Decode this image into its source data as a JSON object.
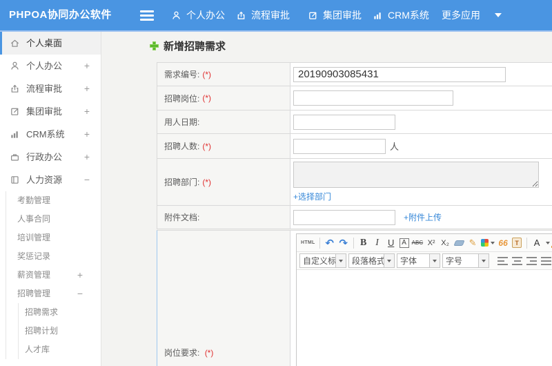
{
  "colors": {
    "topbar": "#4a95e2",
    "link": "#3788d8",
    "required": "#e03131",
    "active_accent": "#4a95e2"
  },
  "topbar": {
    "logo": "PHPOA协同办公软件",
    "menu": [
      {
        "label": "个人办公",
        "icon": "person-icon"
      },
      {
        "label": "流程审批",
        "icon": "flow-icon"
      },
      {
        "label": "集团审批",
        "icon": "edit-icon"
      },
      {
        "label": "CRM系统",
        "icon": "chart-icon"
      },
      {
        "label": "更多应用",
        "icon": "caret-down-icon"
      }
    ]
  },
  "sidebar": {
    "items": [
      {
        "label": "个人桌面",
        "icon": "home-icon",
        "active": true
      },
      {
        "label": "个人办公",
        "icon": "person-icon",
        "toggle": "+"
      },
      {
        "label": "流程审批",
        "icon": "flow-icon",
        "toggle": "+"
      },
      {
        "label": "集团审批",
        "icon": "edit-icon",
        "toggle": "+"
      },
      {
        "label": "CRM系统",
        "icon": "chart-icon",
        "toggle": "+"
      },
      {
        "label": "行政办公",
        "icon": "briefcase-icon",
        "toggle": "+"
      },
      {
        "label": "人力资源",
        "icon": "book-icon",
        "toggle": "−"
      },
      {
        "label": "考勤管理"
      },
      {
        "label": "人事合同"
      },
      {
        "label": "培训管理"
      },
      {
        "label": "奖惩记录"
      },
      {
        "label": "薪资管理",
        "toggle": "+"
      },
      {
        "label": "招聘管理",
        "toggle": "−"
      },
      {
        "label": "招聘需求"
      },
      {
        "label": "招聘计划"
      },
      {
        "label": "人才库"
      }
    ]
  },
  "main": {
    "title": "新增招聘需求",
    "form": {
      "row1": {
        "label": "需求编号:",
        "req": "(*)",
        "value": "20190903085431"
      },
      "row2": {
        "label": "招聘岗位:",
        "req": "(*)",
        "value": ""
      },
      "row3": {
        "label": "用人日期:",
        "value": ""
      },
      "row4": {
        "label": "招聘人数:",
        "req": "(*)",
        "value": "",
        "unit": "人"
      },
      "row5": {
        "label": "招聘部门:",
        "req": "(*)",
        "link": "+选择部门"
      },
      "row6": {
        "label": "附件文档:",
        "value": "",
        "link": "+附件上传"
      },
      "row7": {
        "label": "岗位要求:",
        "req": "(*)"
      }
    },
    "editor": {
      "source_btn": "HTML",
      "undo_glyph": "↶",
      "redo_glyph": "↷",
      "bold": "B",
      "italic": "I",
      "underline": "U",
      "font_box": "A",
      "strike": "ABC",
      "superscript": "X²",
      "subscript": "X₂",
      "brush_glyph": "✎",
      "quote": "66",
      "paste_text": "T",
      "font_color": "A",
      "highlight": "a",
      "heading_dd": "自定义标题",
      "paragraph_dd": "段落格式",
      "font_dd": "字体",
      "size_dd": "字号"
    }
  }
}
